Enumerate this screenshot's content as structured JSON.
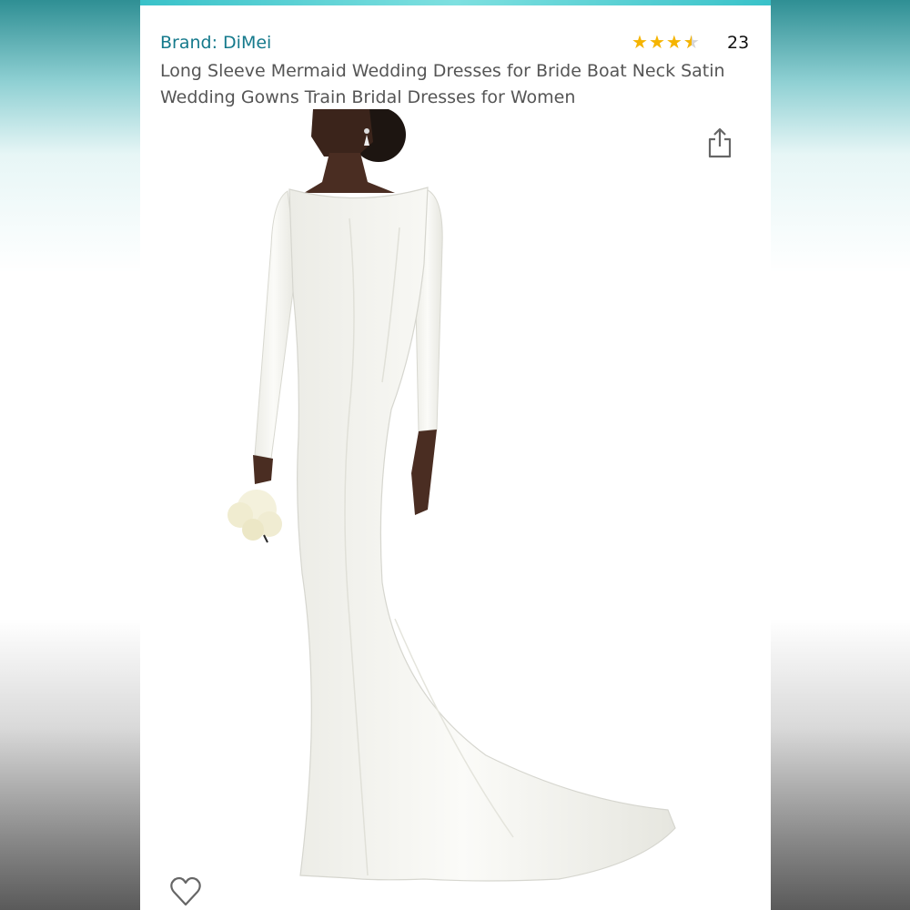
{
  "product": {
    "brand": "Brand: DiMei",
    "title": "Long Sleeve Mermaid Wedding Dresses for Bride Boat Neck Satin Wedding Gowns Train Bridal Dresses for Women",
    "rating": 3.5,
    "rating_max": 5,
    "review_count": "23"
  },
  "colors": {
    "brand_link": "#157a8c",
    "star": "#f5b400",
    "accent_strip": "#39c2c9"
  },
  "icons": {
    "share": "share-icon",
    "wishlist": "heart-icon"
  },
  "image": {
    "subject": "white long-sleeve mermaid wedding dress with train"
  }
}
